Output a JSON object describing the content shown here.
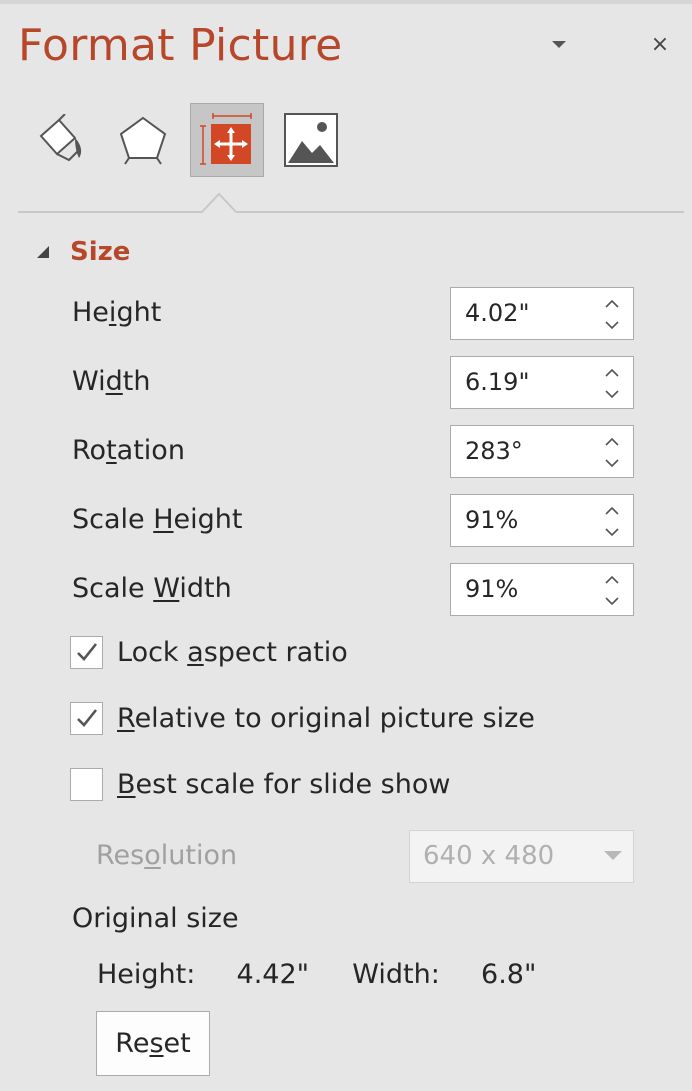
{
  "pane": {
    "title": "Format Picture",
    "close_glyph": "×",
    "menu_icon": "chevron-down-icon"
  },
  "tabs": [
    {
      "name": "fill-line",
      "icon": "paint-bucket-icon",
      "active": false
    },
    {
      "name": "effects",
      "icon": "pentagon-icon",
      "active": false
    },
    {
      "name": "size-properties",
      "icon": "size-properties-icon",
      "active": true
    },
    {
      "name": "picture",
      "icon": "picture-icon",
      "active": false
    }
  ],
  "section": {
    "title": "Size",
    "expanded": true
  },
  "fields": {
    "height": {
      "label_pre": "He",
      "label_u": "i",
      "label_post": "ght",
      "value": "4.02\""
    },
    "width": {
      "label_pre": "Wi",
      "label_u": "d",
      "label_post": "th",
      "value": "6.19\""
    },
    "rotation": {
      "label_pre": "Ro",
      "label_u": "t",
      "label_post": "ation",
      "value": "283°"
    },
    "scale_height": {
      "label_pre": "Scale ",
      "label_u": "H",
      "label_post": "eight",
      "value": "91%"
    },
    "scale_width": {
      "label_pre": "Scale ",
      "label_u": "W",
      "label_post": "idth",
      "value": "91%"
    }
  },
  "checkboxes": {
    "lock_aspect": {
      "label_pre": "Lock ",
      "label_u": "a",
      "label_post": "spect ratio",
      "checked": true
    },
    "relative_original": {
      "label_pre": "",
      "label_u": "R",
      "label_post": "elative to original picture size",
      "checked": true
    },
    "best_scale": {
      "label_pre": "",
      "label_u": "B",
      "label_post": "est scale for slide show",
      "checked": false
    }
  },
  "resolution": {
    "label_pre": "Res",
    "label_u": "o",
    "label_post": "lution",
    "value": "640 x 480",
    "enabled": false
  },
  "original_size": {
    "title": "Original size",
    "height_label": "Height:",
    "height_value": "4.42\"",
    "width_label": "Width:",
    "width_value": "6.8\""
  },
  "reset": {
    "label_pre": "Re",
    "label_u": "s",
    "label_post": "et"
  },
  "colors": {
    "accent": "#b7472a",
    "pane_bg": "#e6e6e6",
    "icon_orange": "#d24726",
    "disabled_text": "#a0a0a0"
  }
}
